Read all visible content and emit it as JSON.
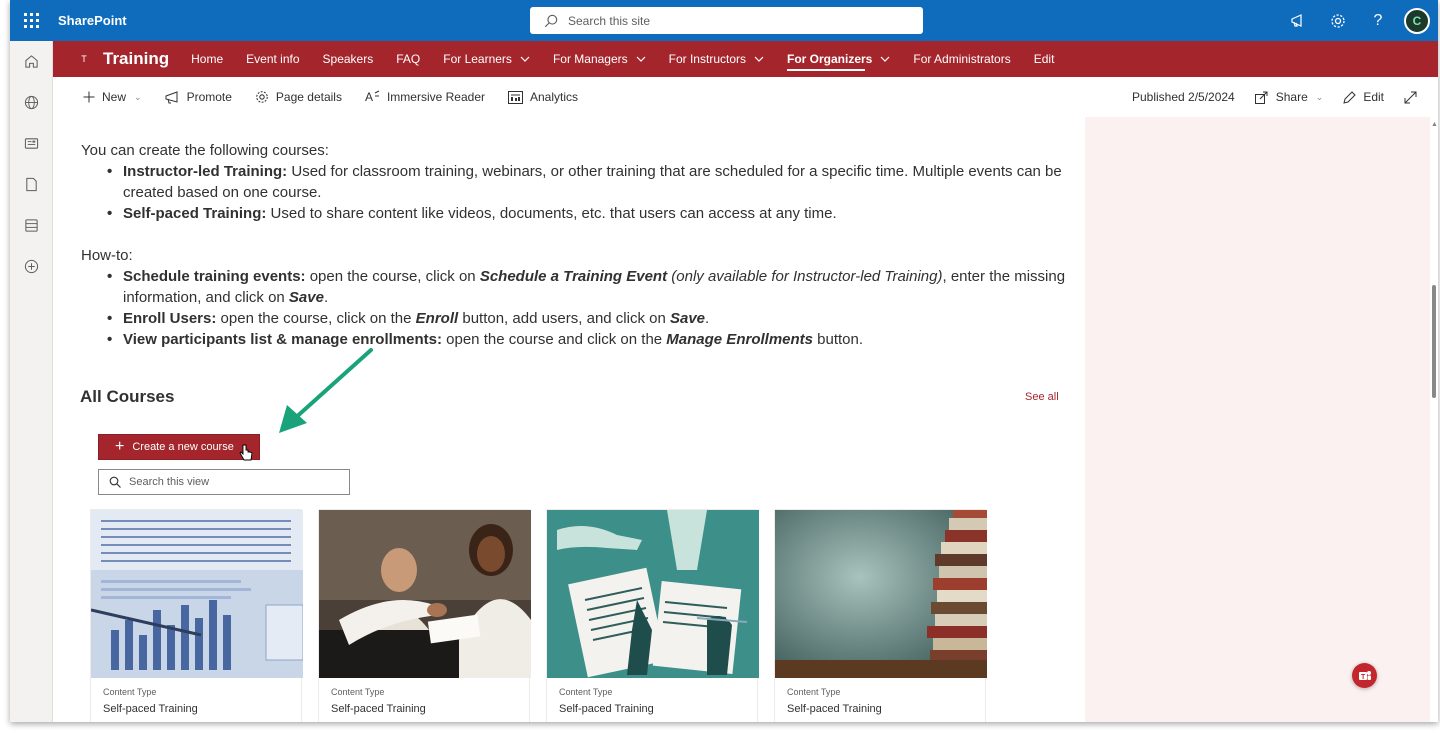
{
  "suite": {
    "brand": "SharePoint",
    "search_placeholder": "Search this site",
    "icons": [
      "waffle-icon",
      "megaphone-icon",
      "gear-icon",
      "help-icon",
      "avatar"
    ]
  },
  "appbar": {
    "icons": [
      "home-icon",
      "globe-icon",
      "news-icon",
      "file-icon",
      "list-icon",
      "add-icon"
    ]
  },
  "sitenav": {
    "logo": "T",
    "title": "Training",
    "items": [
      {
        "label": "Home",
        "dropdown": false,
        "active": false
      },
      {
        "label": "Event info",
        "dropdown": false,
        "active": false
      },
      {
        "label": "Speakers",
        "dropdown": false,
        "active": false
      },
      {
        "label": "FAQ",
        "dropdown": false,
        "active": false
      },
      {
        "label": "For Learners",
        "dropdown": true,
        "active": false
      },
      {
        "label": "For Managers",
        "dropdown": true,
        "active": false
      },
      {
        "label": "For Instructors",
        "dropdown": true,
        "active": false
      },
      {
        "label": "For Organizers",
        "dropdown": true,
        "active": true
      },
      {
        "label": "For Administrators",
        "dropdown": false,
        "active": false
      },
      {
        "label": "Edit",
        "dropdown": false,
        "active": false
      }
    ]
  },
  "cmdbar": {
    "new": "New",
    "promote": "Promote",
    "page_details": "Page details",
    "immersive_reader": "Immersive Reader",
    "analytics": "Analytics",
    "published": "Published 2/5/2024",
    "share": "Share",
    "edit": "Edit"
  },
  "content": {
    "intro": "You can create the following courses:",
    "courses": [
      {
        "bold": "Instructor-led Training:",
        "text": " Used for classroom training, webinars, or other training that are scheduled for a specific time. Multiple events can be created based on one course."
      },
      {
        "bold": "Self-paced Training:",
        "text": " Used to share content like videos, documents, etc. that users can access at any time."
      }
    ],
    "howto": "How-to:",
    "howto_items": {
      "i1_bold": "Schedule training events:",
      "i1_a": " open the course, click on ",
      "i1_em": "Schedule a Training Event",
      "i1_it": " (only available for Instructor-led Training)",
      "i1_b": ", enter the missing information, and click on ",
      "i1_save": "Save",
      "i1_end": ".",
      "i2_bold": "Enroll Users:",
      "i2_a": " open the course, click on the ",
      "i2_em": "Enroll",
      "i2_b": " button, add users, and click on ",
      "i2_save": "Save",
      "i2_end": ".",
      "i3_bold": "View participants list & manage enrollments:",
      "i3_a": " open the course and click on the ",
      "i3_em": "Manage Enrollments",
      "i3_b": " button."
    },
    "all_courses": "All Courses",
    "see_all": "See all",
    "create_button": "Create a new course",
    "search_view_placeholder": "Search this view",
    "cards": [
      {
        "content_type_label": "Content Type",
        "content_type": "Self-paced Training",
        "image": "spreadsheet-chart-photo"
      },
      {
        "content_type_label": "Content Type",
        "content_type": "Self-paced Training",
        "image": "handshake-photo"
      },
      {
        "content_type_label": "Content Type",
        "content_type": "Self-paced Training",
        "image": "documents-illustration"
      },
      {
        "content_type_label": "Content Type",
        "content_type": "Self-paced Training",
        "image": "books-stack-photo"
      }
    ]
  },
  "colors": {
    "suite_blue": "#0f6cbd",
    "site_red": "#a4262c",
    "arrow_green": "#1aa37a",
    "right_pane": "#fbf1f1"
  }
}
